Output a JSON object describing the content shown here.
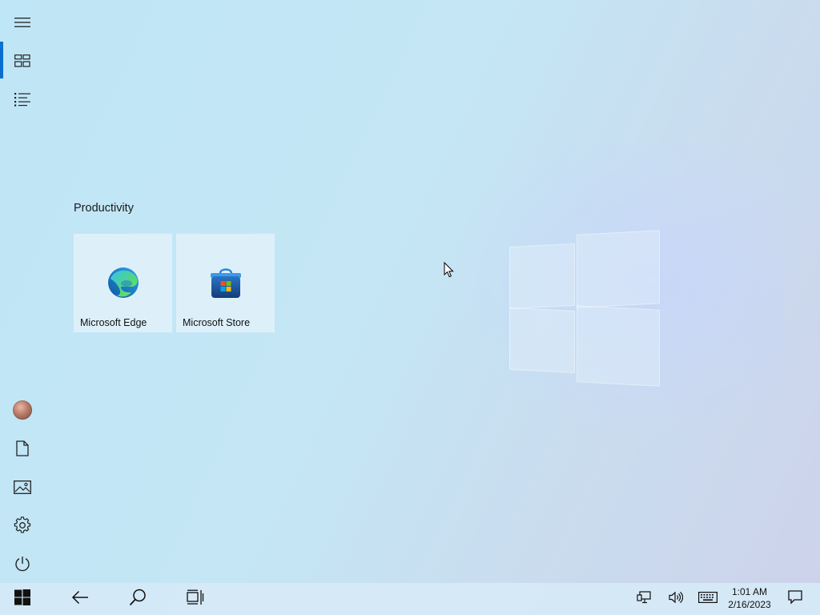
{
  "start": {
    "group_title": "Productivity",
    "tiles": [
      {
        "label": "Microsoft Edge",
        "icon": "edge-icon"
      },
      {
        "label": "Microsoft Store",
        "icon": "store-icon"
      }
    ]
  },
  "rail": {
    "top_icons": [
      "hamburger-menu-icon",
      "pinned-tiles-icon",
      "all-apps-list-icon"
    ],
    "bottom_icons": [
      "user-avatar",
      "documents-icon",
      "pictures-icon",
      "settings-gear-icon",
      "power-icon"
    ]
  },
  "taskbar": {
    "left_icons": [
      "windows-start-icon",
      "back-arrow-icon",
      "search-icon",
      "task-view-icon"
    ],
    "tray_icons": [
      "network-icon",
      "volume-icon",
      "touch-keyboard-icon",
      "action-center-icon"
    ],
    "clock": {
      "time": "1:01 AM",
      "date": "2/16/2023"
    }
  },
  "colors": {
    "accent": "#0a6ed1",
    "edge_blue": "#1c8fd8",
    "edge_green": "#4fd27b",
    "store_blue": "#1f5ea8"
  }
}
